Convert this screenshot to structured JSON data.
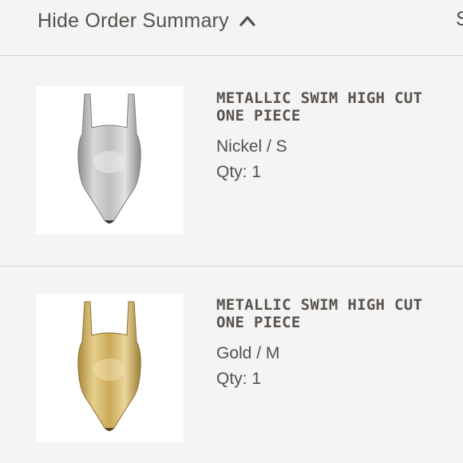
{
  "header": {
    "toggle_label": "Hide Order Summary",
    "toggle_icon": "chevron-up-icon",
    "right_peek": "S"
  },
  "items": [
    {
      "title": "METALLIC SWIM HIGH CUT ONE PIECE",
      "variant": "Nickel / S",
      "qty": "Qty: 1",
      "image_icon": "silver-swimsuit-image",
      "swatch": "#c9c9c9"
    },
    {
      "title": "METALLIC SWIM HIGH CUT ONE PIECE",
      "variant": "Gold / M",
      "qty": "Qty: 1",
      "image_icon": "gold-swimsuit-image",
      "swatch": "#d8bc6e"
    }
  ],
  "colors": {
    "background": "#f4f4f4",
    "text": "#55504c",
    "divider": "#d6d6d6"
  }
}
